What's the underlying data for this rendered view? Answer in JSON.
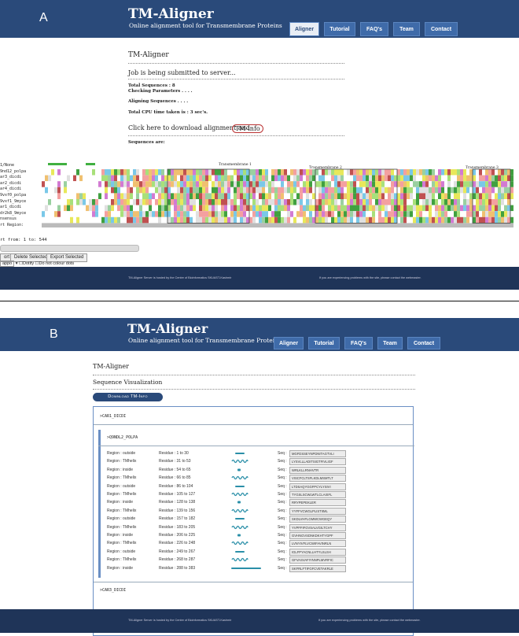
{
  "panel_a": {
    "letter": "A",
    "header": {
      "title": "TM-Aligner",
      "subtitle": "Online alignment tool for Transmembrane Proteins"
    },
    "nav": [
      {
        "label": "Aligner",
        "active": true
      },
      {
        "label": "Tutorial"
      },
      {
        "label": "FAQ's"
      },
      {
        "label": "Team"
      },
      {
        "label": "Contact"
      }
    ],
    "page_title": "TM-Aligner",
    "status": "Job is being submitted to server...",
    "total_sequences": "Total Sequences : 8",
    "checking": "Checking Parameters . . . .",
    "aligning": "Aligning Sequences . . . .",
    "cpu_time": "Total CPU time taken is : 3 sec's.",
    "download_prefix": "Click here to download alignment and",
    "download_link": "TM-info",
    "sequences_are": "Sequences are:",
    "alignment": {
      "names": [
        "1/None",
        "9nd12_polpa",
        "ar3_dicdi",
        "ar2_dicdi",
        "ar4_dicdi",
        "9vxf0_polpa",
        "9vxf1_9myce",
        "ar1_dicdi",
        "dr2k8_9myce",
        "nsensus",
        "rt Region:"
      ],
      "annotations": [
        "Transmembrane 1",
        "Transmembrane 2",
        "Transmembrane 3"
      ]
    },
    "range": "rt from: 1 to: 544",
    "buttons": [
      "ort",
      "Delete Selected",
      "Export Selected"
    ],
    "options": {
      "select": "appo",
      "dotify": "Dotify",
      "no_colour": "Do not colour dots"
    },
    "footer_left": "TM-Aligner Server is hosted by the Centre of Bioinformatics SKUAST-Kashmir",
    "footer_right": "If you are experiencing problems with the site, please contact the webmaster."
  },
  "panel_b": {
    "letter": "B",
    "header": {
      "title": "TM-Aligner",
      "subtitle": "Online alignment tool for Transmembrane Proteins"
    },
    "nav": [
      {
        "label": "Aligner"
      },
      {
        "label": "Tutorial"
      },
      {
        "label": "FAQ's"
      },
      {
        "label": "Team"
      },
      {
        "label": "Contact"
      }
    ],
    "page_title": "TM-Aligner",
    "section_title": "Sequence Visualization",
    "download_button": "Download TM-Info",
    "seq_headers": [
      ">CAR1_DICDI",
      ">Q9NDL2_POLPA",
      ">CAR3_DICDI"
    ],
    "regions": [
      {
        "region": "Region : outside",
        "residue": "Residue : 1 to 30",
        "type": "outside",
        "seq": "MGFDSSEYNPDNITAGTVLI"
      },
      {
        "region": "Region : TMhelix",
        "residue": "Residue : 31 to 53",
        "type": "helix",
        "seq": "LYSVLLLADITSIGTFIVLIGF"
      },
      {
        "region": "Region : inside",
        "residue": "Residue : 54 to 65",
        "type": "inside",
        "seq": "WRLKLLRNHVTR"
      },
      {
        "region": "Region : TMhelix",
        "residue": "Residue : 66 to 85",
        "type": "helix",
        "seq": "VISCFCLTSFLKDLMSMTLT"
      },
      {
        "region": "Region : outside",
        "residue": "Residue : 86 to 104",
        "type": "outside",
        "seq": "LTDSAQYGGFPCYLYSIVI"
      },
      {
        "region": "Region : TMhelix",
        "residue": "Residue : 105 to 127",
        "type": "helix",
        "seq": "TYGSLSCWLWTLCLAISFL"
      },
      {
        "region": "Region : inside",
        "residue": "Residue : 128 to 138",
        "type": "inside",
        "seq": "RRYPEPEKLER"
      },
      {
        "region": "Region : TMhelix",
        "residue": "Residue : 139 to 156",
        "type": "helix",
        "seq": "YYFFVCWGLPLISTIIML"
      },
      {
        "region": "Region : outside",
        "residue": "Residue : 157 to 182",
        "type": "outside",
        "seq": "SKDLVHFLGMWCWGEQY"
      },
      {
        "region": "Region : TMhelix",
        "residue": "Residue : 183 to 205",
        "type": "helix",
        "seq": "YVPFFIFGVSALVGILTCHY"
      },
      {
        "region": "Region : inside",
        "residue": "Residue : 206 to 225",
        "type": "inside",
        "seq": "GVHNGVSDNKDKHTYGPF"
      },
      {
        "region": "Region : TMhelix",
        "residue": "Residue : 226 to 248",
        "type": "helix",
        "seq": "LVNYIVFLVCWIFAVINRLN"
      },
      {
        "region": "Region : outside",
        "residue": "Residue : 249 to 267",
        "type": "outside",
        "seq": "IGLFPYACNLLHTYLSLSH"
      },
      {
        "region": "Region : TMhelix",
        "residue": "Residue : 268 to 287",
        "type": "helix",
        "seq": "GFVASVAFIYNNPLMVRFIC"
      },
      {
        "region": "Region : inside",
        "residue": "Residue : 288 to 383",
        "type": "inside-long",
        "seq": "SKFRLFTIFGFCVETAKRLE"
      }
    ],
    "footer_left": "TM-Aligner Server is hosted by the Centre of Bioinformatics SKUAST-Kashmir",
    "footer_right": "If you are experiencing problems with the site, please contact the webmaster."
  },
  "colors": {
    "header_bg": "#2a4a7a",
    "nav_btn": "#3f6ba9",
    "footer_bg": "#1f3458",
    "helix": "#2a8fa8"
  }
}
